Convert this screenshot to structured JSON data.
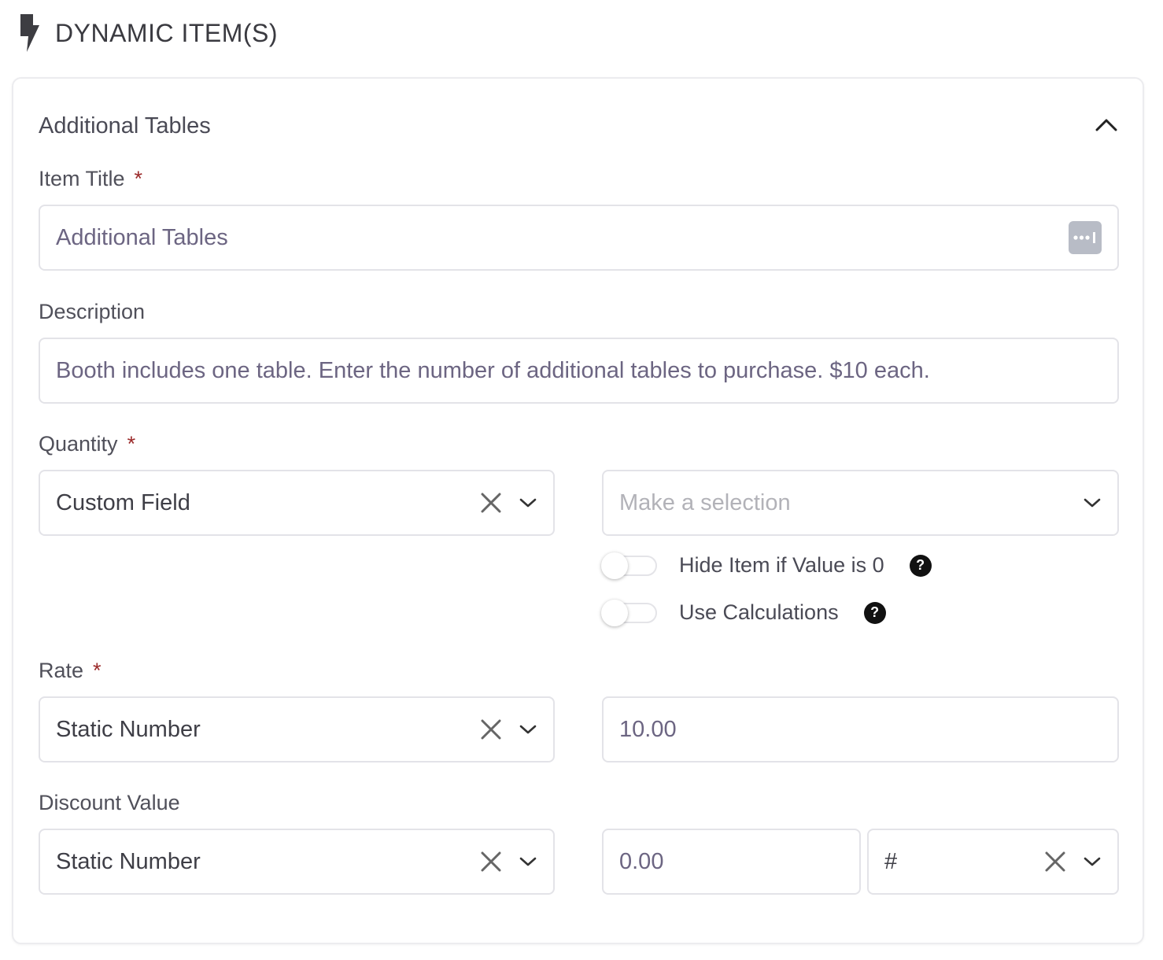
{
  "header": {
    "title": "DYNAMIC ITEM(S)",
    "icon": "bolt-icon"
  },
  "section": {
    "title": "Additional Tables"
  },
  "item_title": {
    "label": "Item Title",
    "required_mark": "*",
    "value": "Additional Tables"
  },
  "description": {
    "label": "Description",
    "value": "Booth includes one table. Enter the number of additional tables to purchase. $10 each."
  },
  "quantity": {
    "label": "Quantity",
    "required_mark": "*",
    "type_value": "Custom Field",
    "selection_placeholder": "Make a selection",
    "toggles": [
      {
        "label": "Hide Item if Value is 0",
        "on": false,
        "help": "?"
      },
      {
        "label": "Use Calculations",
        "on": false,
        "help": "?"
      }
    ]
  },
  "rate": {
    "label": "Rate",
    "required_mark": "*",
    "type_value": "Static Number",
    "amount": "10.00"
  },
  "discount": {
    "label": "Discount Value",
    "type_value": "Static Number",
    "amount": "0.00",
    "unit": "#"
  },
  "colors": {
    "required": "#9b2a2a",
    "border": "#e3e3e8",
    "value_text": "#6c6582"
  }
}
